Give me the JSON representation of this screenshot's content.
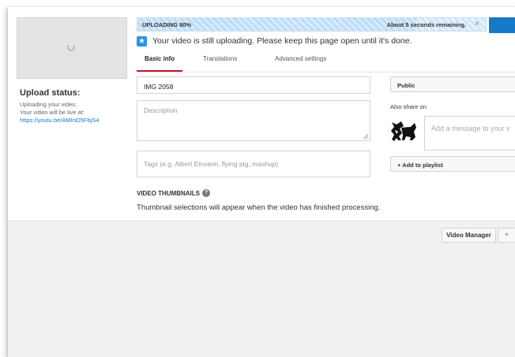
{
  "progress": {
    "label": "UPLOADING 80%",
    "percent": 80,
    "remaining": "About 5 seconds remaining.",
    "close_symbol": "×"
  },
  "notice": {
    "icon": "star-icon",
    "text": "Your video is still uploading. Please keep this page open until it's done."
  },
  "tabs": [
    {
      "label": "Basic info",
      "active": true
    },
    {
      "label": "Translations",
      "active": false
    },
    {
      "label": "Advanced settings",
      "active": false
    }
  ],
  "upload_status": {
    "title": "Upload status:",
    "line1": "Uploading your video.",
    "line2": "Your video will be live at:",
    "url": "https://youtu.be/AMInO5FbjS4"
  },
  "form": {
    "title_value": "IMG 2058",
    "description_placeholder": "Description",
    "tags_placeholder": "Tags (e.g. Albert Einstein, flying pig, mashup)"
  },
  "privacy": {
    "selected": "Public"
  },
  "share": {
    "label": "Also share on",
    "message_placeholder": "Add a message to your v"
  },
  "playlist": {
    "label": "+ Add to playlist"
  },
  "thumbnails": {
    "heading": "VIDEO THUMBNAILS",
    "text": "Thumbnail selections will appear when the video has finished processing."
  },
  "footer": {
    "video_manager_label": "Video Manager",
    "plus_label": "+"
  },
  "colors": {
    "accent_blue": "#167ac6",
    "tab_underline": "#cc181e",
    "star_blue": "#2793e6"
  }
}
